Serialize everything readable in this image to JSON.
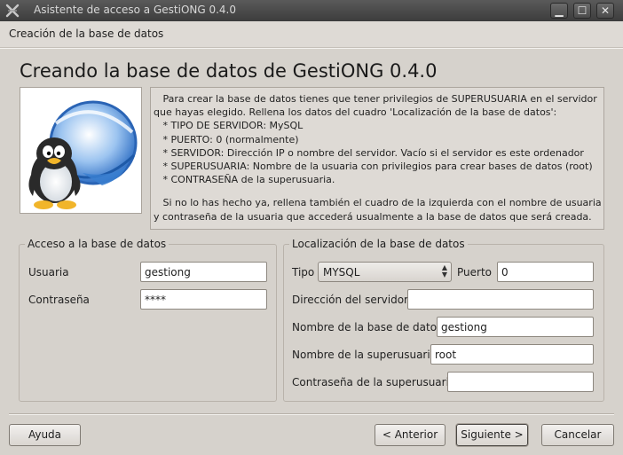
{
  "window": {
    "title": "Asistente de acceso a GestiONG 0.4.0",
    "minimize_glyph": "▁",
    "maximize_glyph": "☐",
    "close_glyph": "✕"
  },
  "page": {
    "header": "Creación de la base de datos",
    "title": "Creando la base de datos de GestiONG 0.4.0"
  },
  "info": {
    "lines": [
      "   Para crear la base de datos tienes que tener privilegios de SUPERUSUARIA en el servidor",
      "que hayas elegido. Rellena los datos del cuadro 'Localización de la base de datos':",
      "   * TIPO DE SERVIDOR: MySQL",
      "   * PUERTO: 0 (normalmente)",
      "   * SERVIDOR: Dirección IP o nombre del servidor. Vacío si el servidor es este ordenador",
      "   * SUPERUSUARIA: Nombre de la usuaria con privilegios para crear bases de datos (root)",
      "   * CONTRASEÑA de la superusuaria."
    ],
    "lines2": [
      "   Si no lo has hecho ya, rellena también el cuadro de la izquierda con el nombre de usuaria",
      "y contraseña de la usuaria que accederá usualmente a la base de datos que será creada."
    ]
  },
  "access": {
    "legend": "Acceso a la base de datos",
    "user_label": "Usuaria",
    "user_value": "gestiong",
    "password_label": "Contraseña",
    "password_value": "****"
  },
  "location": {
    "legend": "Localización de la base de datos",
    "type_label": "Tipo",
    "type_value": "MYSQL",
    "port_label": "Puerto",
    "port_value": "0",
    "server_label": "Dirección del servidor",
    "server_value": "",
    "dbname_label": "Nombre de la base de datos",
    "dbname_value": "gestiong",
    "superuser_label": "Nombre de la superusuaria",
    "superuser_value": "root",
    "superpass_label": "Contraseña de la superusuaria",
    "superpass_value": ""
  },
  "buttons": {
    "help": "Ayuda",
    "back": "< Anterior",
    "next": "Siguiente >",
    "cancel": "Cancelar"
  },
  "colors": {
    "titlebar": "#4a4a4a",
    "window_bg": "#d6d2cc",
    "penguin_blue": "#3a7fd0"
  }
}
